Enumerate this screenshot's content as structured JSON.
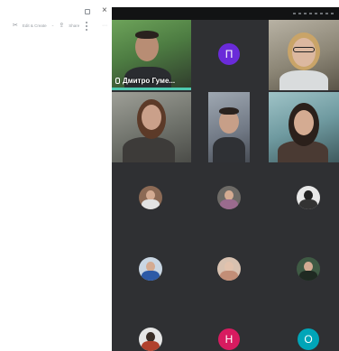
{
  "toolbar": {
    "edit_label": "Edit & Create",
    "share_label": "Share"
  },
  "participants": {
    "tile_1_name": "Дмитро Гуме...",
    "tile_2_initial": "П",
    "initial_h": "Н",
    "initial_o": "О"
  },
  "colors": {
    "initial_p": "#6a2bd9",
    "initial_h": "#d81b60",
    "initial_o": "#00a5b8",
    "speaking": "#4ec9b0",
    "meeting_bg": "#2f3033"
  }
}
